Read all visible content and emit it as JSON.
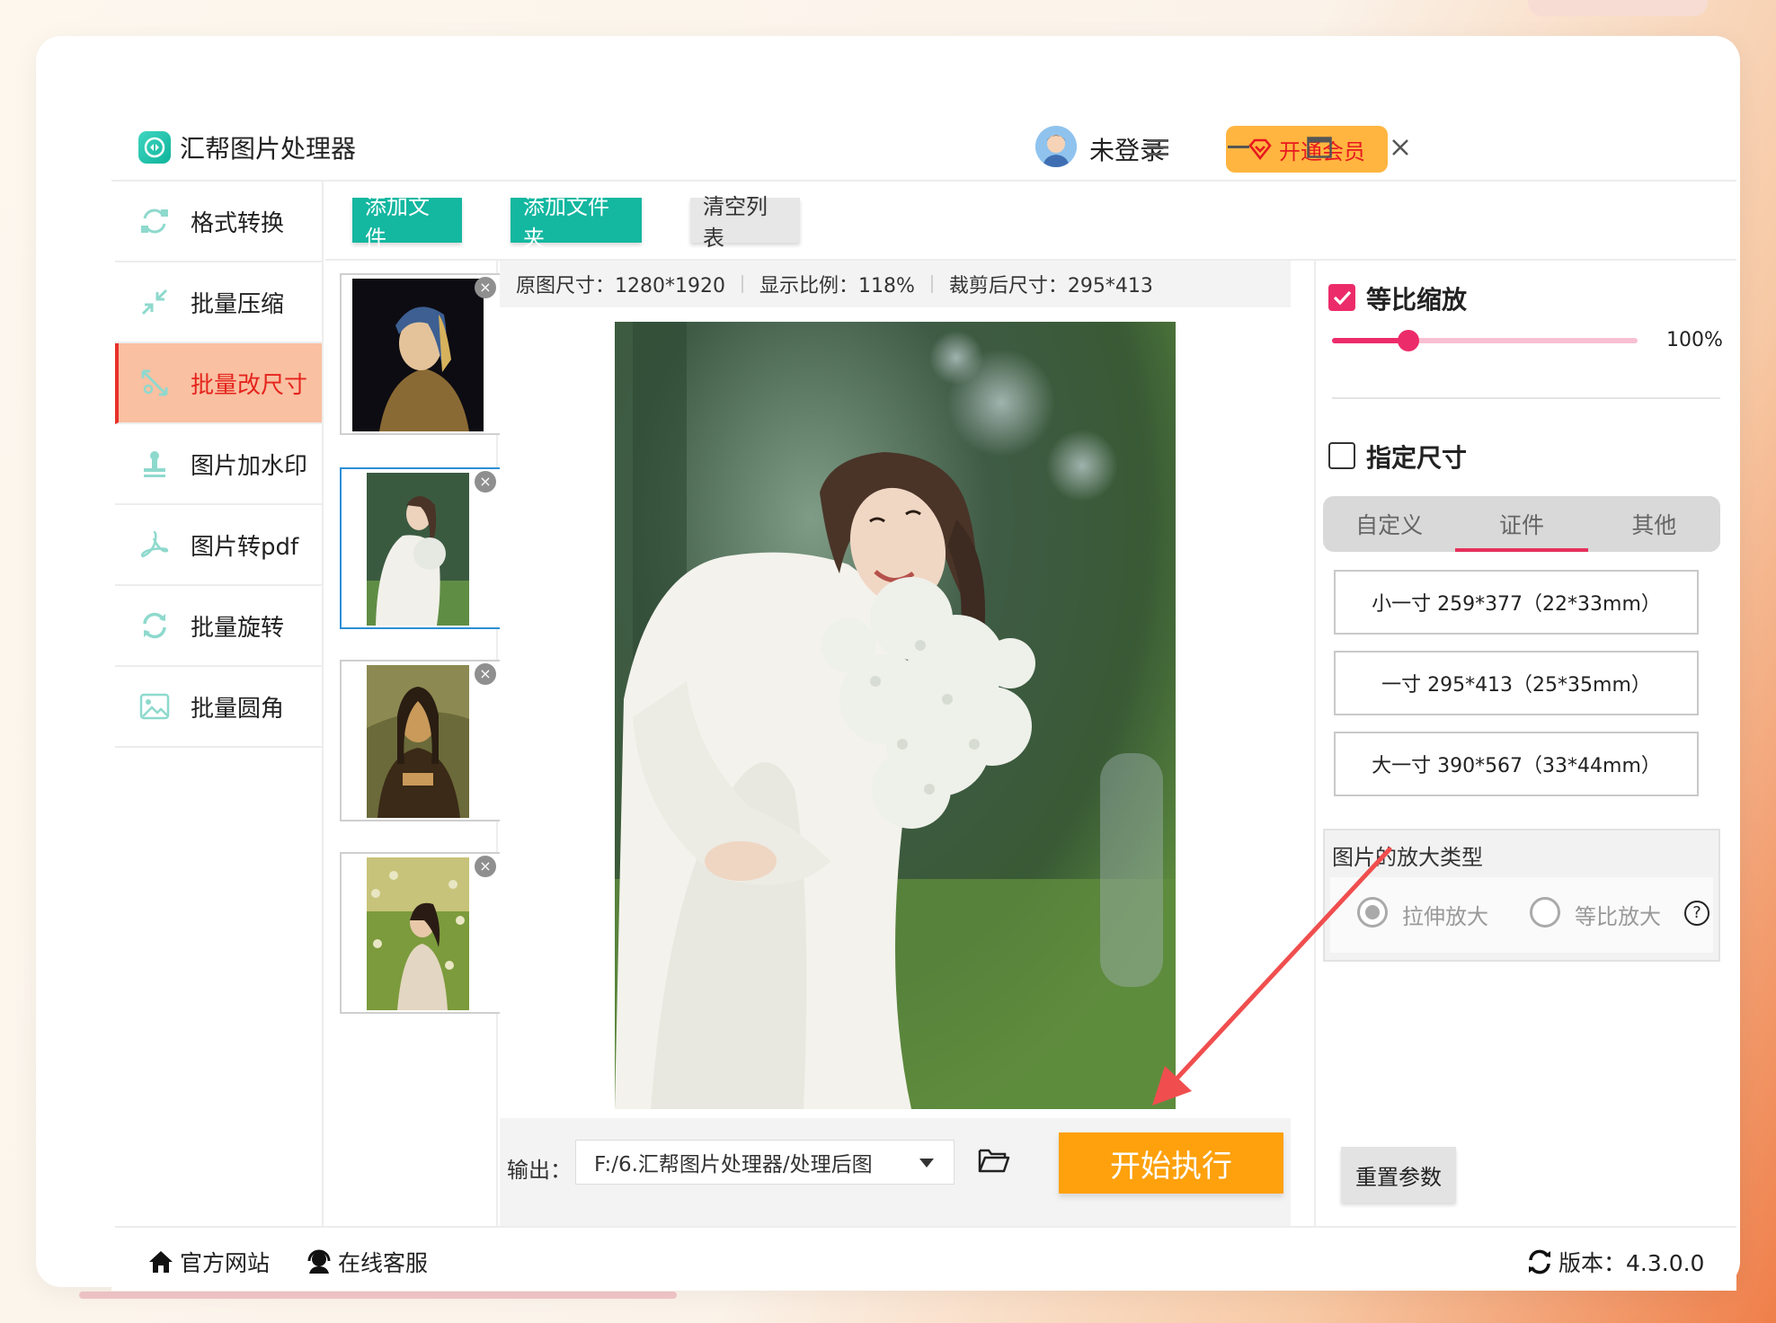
{
  "app": {
    "title": "汇帮图片处理器",
    "user_status": "未登录",
    "vip_button": "开通会员"
  },
  "sidebar": {
    "items": [
      {
        "label": "格式转换",
        "icon": "format-convert-icon",
        "active": false
      },
      {
        "label": "批量压缩",
        "icon": "compress-icon",
        "active": false
      },
      {
        "label": "批量改尺寸",
        "icon": "resize-icon",
        "active": true
      },
      {
        "label": "图片加水印",
        "icon": "watermark-icon",
        "active": false
      },
      {
        "label": "图片转pdf",
        "icon": "pdf-icon",
        "active": false
      },
      {
        "label": "批量旋转",
        "icon": "rotate-icon",
        "active": false
      },
      {
        "label": "批量圆角",
        "icon": "round-corner-icon",
        "active": false
      }
    ]
  },
  "toolbar": {
    "add_file": "添加文件",
    "add_folder": "添加文件夹",
    "clear_list": "清空列表"
  },
  "thumbnails": [
    {
      "name": "girl-with-pearl-earring",
      "selected": false
    },
    {
      "name": "girl-with-flowers",
      "selected": true
    },
    {
      "name": "mona-lisa",
      "selected": false
    },
    {
      "name": "girl-in-field",
      "selected": false
    }
  ],
  "preview": {
    "original_size": "原图尺寸：1280*1920",
    "display_ratio": "显示比例：118%",
    "cropped_size": "裁剪后尺寸：295*413"
  },
  "output": {
    "label": "输出：",
    "path": "F:/6.汇帮图片处理器/处理后图",
    "start_button": "开始执行"
  },
  "settings": {
    "proportional_label": "等比缩放",
    "proportional_checked": true,
    "scale_percent_text": "100%",
    "scale_fraction": 0.25,
    "specify_size_label": "指定尺寸",
    "specify_size_checked": false,
    "tabs": [
      "自定义",
      "证件",
      "其他"
    ],
    "active_tab": 1,
    "sizes": [
      "小一寸  259*377（22*33mm）",
      "一寸  295*413（25*35mm）",
      "大一寸  390*567（33*44mm）"
    ],
    "zoom_type_title": "图片的放大类型",
    "zoom_options": [
      "拉伸放大",
      "等比放大"
    ],
    "zoom_selected": 0,
    "help": "?",
    "reset_button": "重置参数"
  },
  "footer": {
    "official_site": "官方网站",
    "online_service": "在线客服",
    "version": "版本：4.3.0.0"
  },
  "colors": {
    "accent_green": "#14b7a0",
    "accent_pink": "#ec2c6a",
    "start_orange": "#fea10c",
    "vip_yellow": "#ffb540",
    "arrow_red": "#f04e4e"
  }
}
